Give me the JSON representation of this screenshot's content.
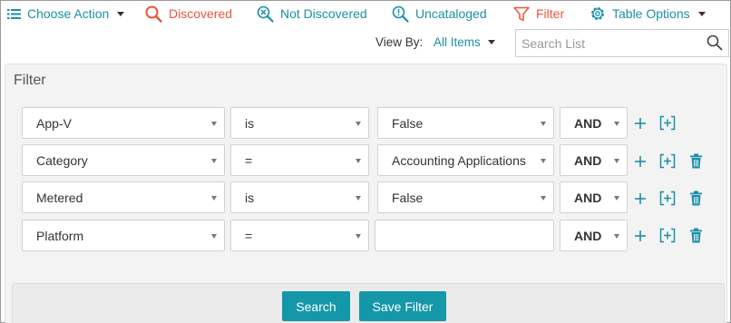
{
  "toolbar": {
    "choose_action": "Choose Action",
    "discovered": "Discovered",
    "not_discovered": "Not Discovered",
    "uncataloged": "Uncataloged",
    "filter": "Filter",
    "table_options": "Table Options"
  },
  "view_by": {
    "label": "View By:",
    "value": "All Items"
  },
  "search": {
    "placeholder": "Search List"
  },
  "filter_panel": {
    "title": "Filter",
    "rows": [
      {
        "field": "App-V",
        "operator": "is",
        "value": "False",
        "conjunction": "AND"
      },
      {
        "field": "Category",
        "operator": "=",
        "value": "Accounting Applications",
        "conjunction": "AND"
      },
      {
        "field": "Metered",
        "operator": "is",
        "value": "False",
        "conjunction": "AND"
      },
      {
        "field": "Platform",
        "operator": "=",
        "value": "",
        "conjunction": "AND"
      }
    ]
  },
  "footer": {
    "search_label": "Search",
    "save_filter_label": "Save Filter"
  },
  "colors": {
    "accent": "#1b8fa6",
    "active": "#e8573a",
    "button": "#1497a8"
  }
}
